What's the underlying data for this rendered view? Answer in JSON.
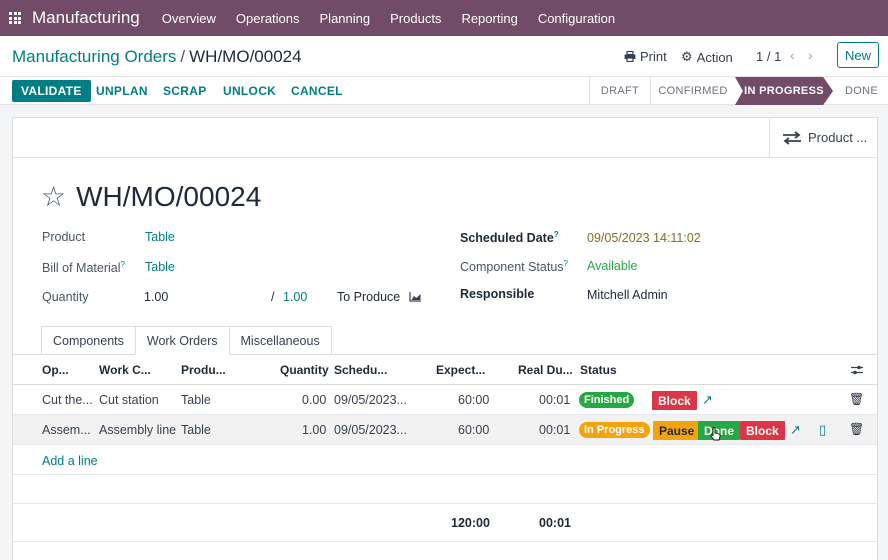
{
  "app": {
    "name": "Manufacturing"
  },
  "menu": [
    "Overview",
    "Operations",
    "Planning",
    "Products",
    "Reporting",
    "Configuration"
  ],
  "breadcrumb": {
    "parent": "Manufacturing Orders",
    "separator": "/",
    "current": "WH/MO/00024"
  },
  "control": {
    "print": "Print",
    "action": "Action",
    "pager": "1 / 1",
    "new": "New"
  },
  "actions": {
    "validate": "VALIDATE",
    "unplan": "UNPLAN",
    "scrap": "SCRAP",
    "unlock": "UNLOCK",
    "cancel": "CANCEL"
  },
  "stages": [
    "DRAFT",
    "CONFIRMED",
    "IN PROGRESS",
    "DONE"
  ],
  "active_stage": "IN PROGRESS",
  "smart_button": {
    "label": "Product ..."
  },
  "record": {
    "title": "WH/MO/00024",
    "product_label": "Product",
    "product": "Table",
    "bom_label": "Bill of Material",
    "bom": "Table",
    "quantity_label": "Quantity",
    "quantity": "1.00",
    "quantity_sep": "/",
    "quantity_to_produce": "1.00",
    "to_produce_label": "To Produce",
    "scheduled_label": "Scheduled Date",
    "scheduled": "09/05/2023 14:11:02",
    "component_status_label": "Component Status",
    "component_status": "Available",
    "responsible_label": "Responsible",
    "responsible": "Mitchell Admin",
    "help_mark": "?"
  },
  "tabs": [
    "Components",
    "Work Orders",
    "Miscellaneous"
  ],
  "table": {
    "headers": {
      "operation": "Op...",
      "work_center": "Work C...",
      "product": "Produ...",
      "quantity": "Quantity",
      "scheduled": "Schedu...",
      "expected": "Expect...",
      "real": "Real Du...",
      "status": "Status"
    },
    "rows": [
      {
        "operation": "Cut the...",
        "work_center": "Cut station",
        "product": "Table",
        "quantity": "0.00",
        "scheduled": "09/05/2023...",
        "expected": "60:00",
        "real": "00:01",
        "status": "Finished"
      },
      {
        "operation": "Assem...",
        "work_center": "Assembly line",
        "product": "Table",
        "quantity": "1.00",
        "scheduled": "09/05/2023...",
        "expected": "60:00",
        "real": "00:01",
        "status": "In Progress"
      }
    ],
    "buttons": {
      "block": "Block",
      "pause": "Pause",
      "done": "Done"
    },
    "add_line": "Add a line",
    "totals": {
      "expected": "120:00",
      "real": "00:01"
    }
  },
  "colors": {
    "brand": "#714b67",
    "accent": "#017e84",
    "finished": "#28a745",
    "in_progress": "#f3a40c",
    "block": "#dc3545",
    "pause": "#f3a40c",
    "done": "#28a745"
  }
}
